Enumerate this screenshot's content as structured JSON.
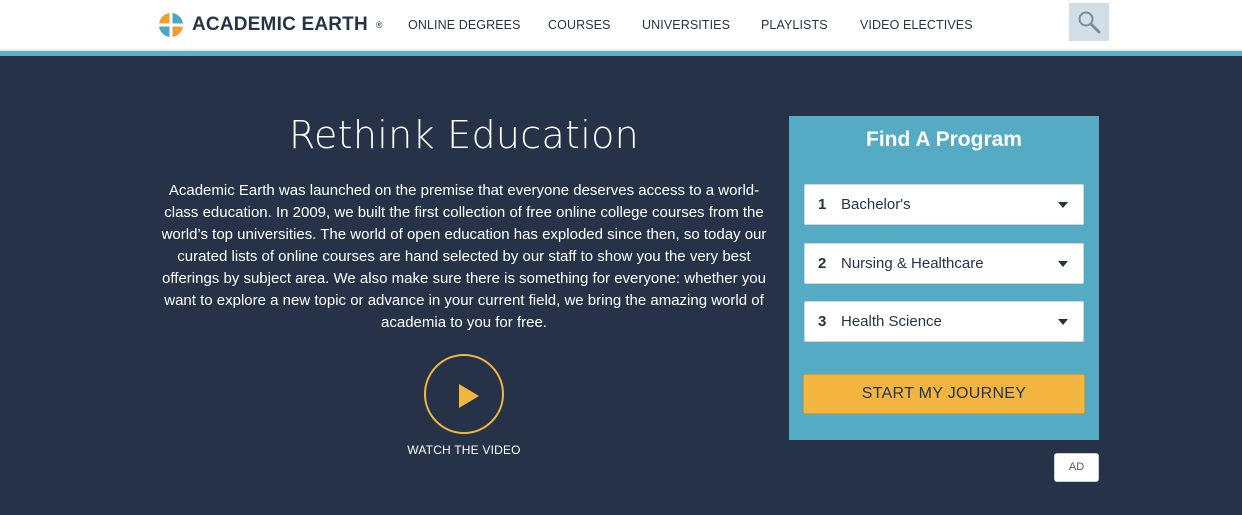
{
  "header": {
    "logo_text": "ACADEMIC EARTH",
    "logo_reg": "®",
    "nav": [
      {
        "label": "ONLINE DEGREES"
      },
      {
        "label": "COURSES"
      },
      {
        "label": "UNIVERSITIES"
      },
      {
        "label": "PLAYLISTS"
      },
      {
        "label": "VIDEO ELECTIVES"
      }
    ],
    "search_icon": "search-icon"
  },
  "hero": {
    "title": "Rethink Education",
    "body": "Academic Earth was launched on the premise that everyone deserves access to a world-class education. In 2009, we built the first collection of free online college courses from the world’s top universities. The world of open education has exploded since then, so today our curated lists of online courses are hand selected by our staff to show you the very best offerings by subject area. We also make sure there is something for everyone: whether you want to explore a new topic or advance in your current field, we bring the amazing world of academia to you for free.",
    "video_label": "WATCH THE VIDEO"
  },
  "finder": {
    "title": "Find A Program",
    "selects": [
      {
        "step": "1",
        "value": "Bachelor's"
      },
      {
        "step": "2",
        "value": "Nursing & Healthcare"
      },
      {
        "step": "3",
        "value": "Health Science"
      }
    ],
    "cta": "START MY JOURNEY",
    "ad_badge": "AD"
  },
  "colors": {
    "background": "#263248",
    "accent_blue": "#55abc4",
    "accent_yellow": "#f2b640",
    "text_dark": "#243447"
  }
}
